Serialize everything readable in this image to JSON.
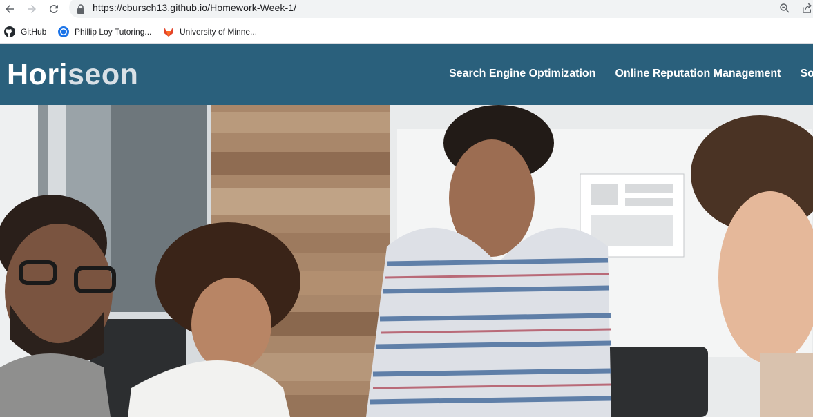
{
  "browser": {
    "url": "https://cbursch13.github.io/Homework-Week-1/",
    "bookmarks": [
      {
        "label": "GitHub",
        "icon": "github-icon"
      },
      {
        "label": "Phillip Loy Tutoring...",
        "icon": "tutoring-icon"
      },
      {
        "label": "University of Minne...",
        "icon": "gitlab-icon"
      }
    ]
  },
  "site": {
    "logo_left": "Hori",
    "logo_right": "seon",
    "nav": [
      {
        "label": "Search Engine Optimization"
      },
      {
        "label": "Online Reputation Management"
      },
      {
        "label": "Social Media Marketing"
      }
    ]
  },
  "colors": {
    "header_bg": "#2a607c",
    "logo_accent": "#d9e0e6"
  }
}
